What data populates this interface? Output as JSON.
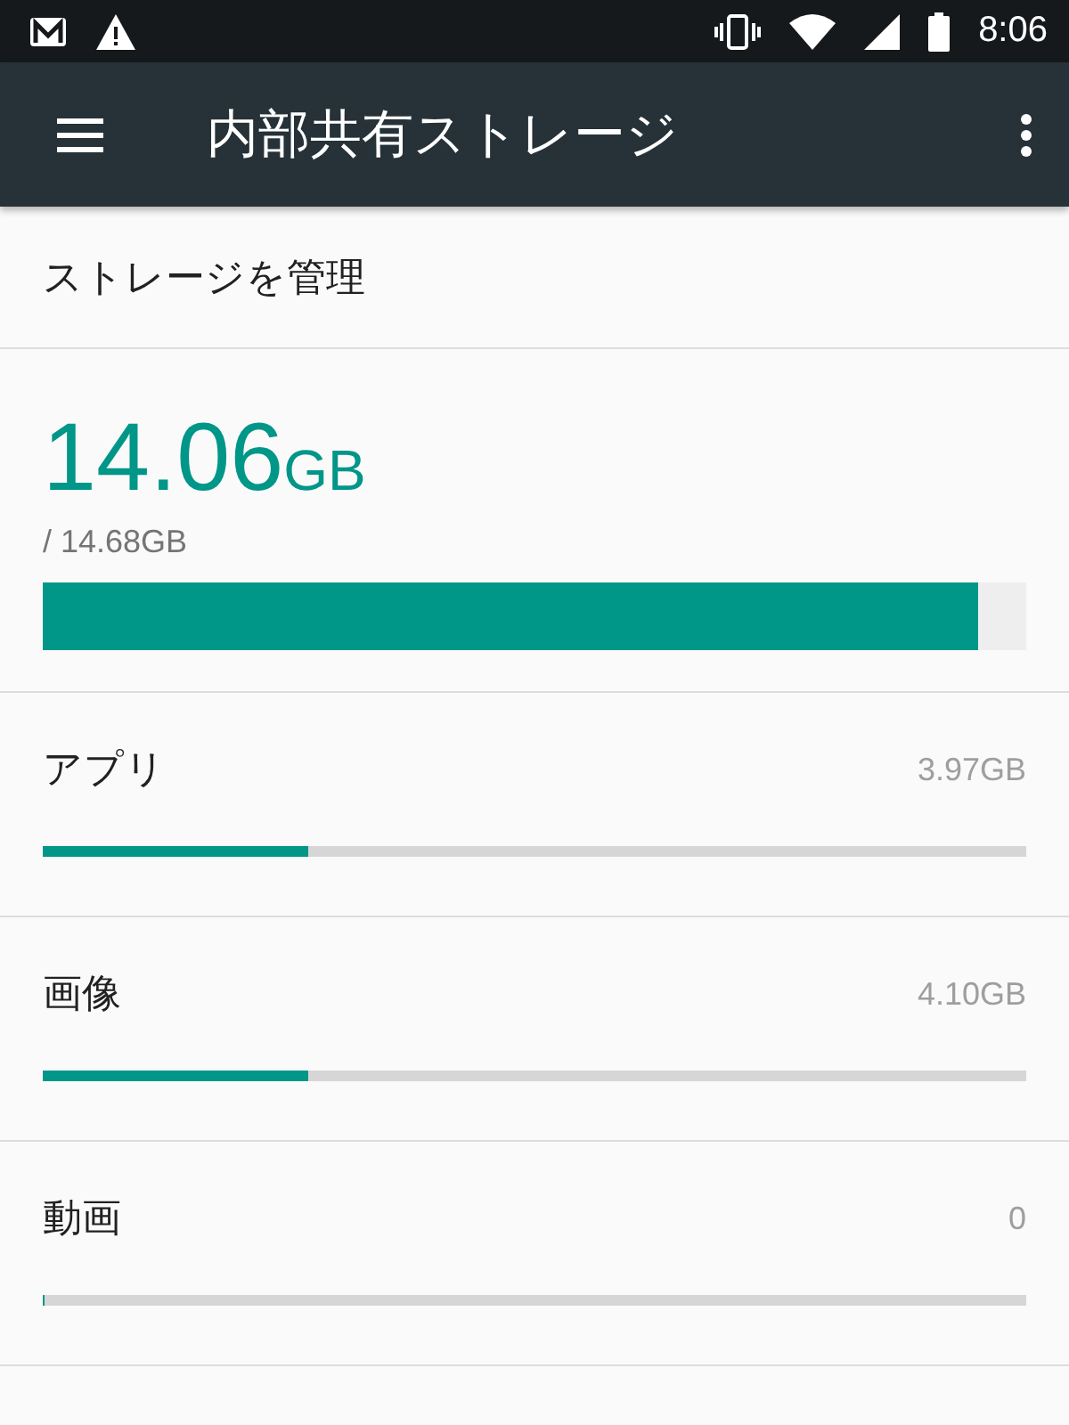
{
  "status_bar": {
    "time": "8:06"
  },
  "toolbar": {
    "title": "内部共有ストレージ"
  },
  "manage": {
    "label": "ストレージを管理"
  },
  "summary": {
    "used": "14.06",
    "used_unit": "GB",
    "total": "/ 14.68GB",
    "level": 0.951
  },
  "categories": [
    {
      "name": "アプリ",
      "size": "3.97GB",
      "level": 0.27
    },
    {
      "name": "画像",
      "size": "4.10GB",
      "level": 0.27
    },
    {
      "name": "動画",
      "size": "0",
      "level": 0
    }
  ]
}
